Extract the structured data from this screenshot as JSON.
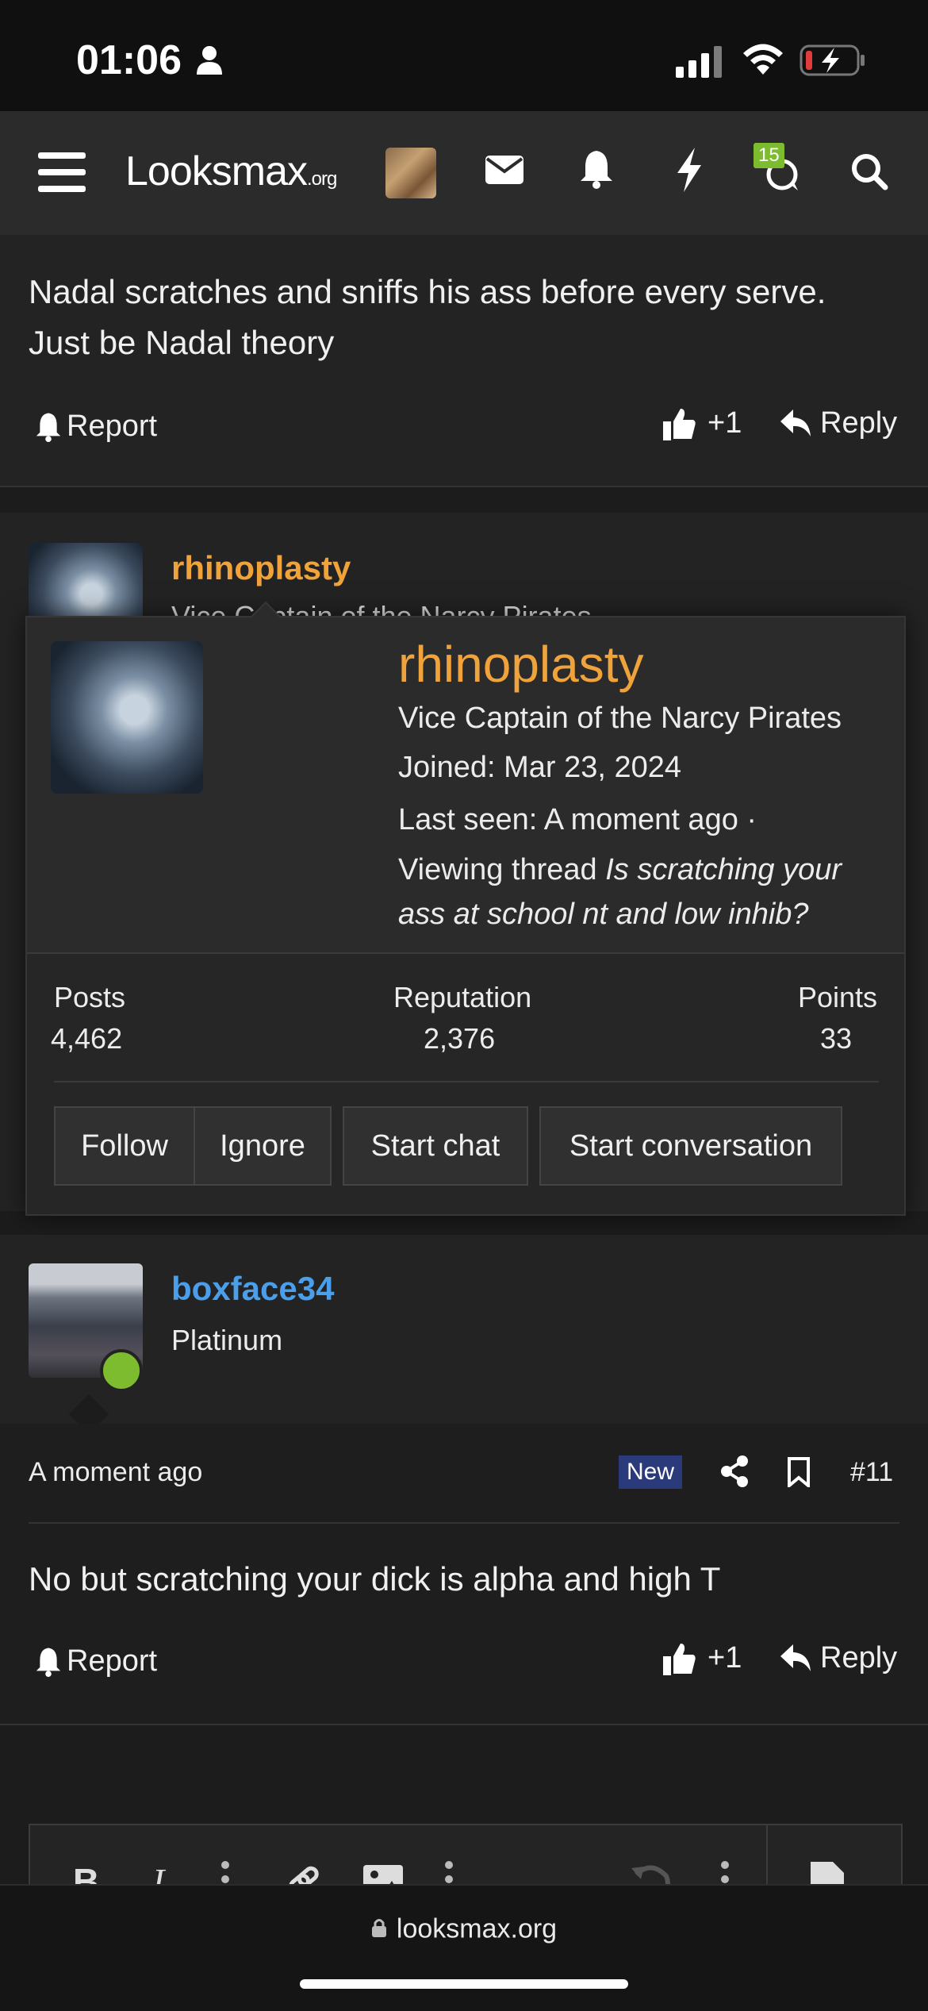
{
  "status_bar": {
    "time": "01:06"
  },
  "nav": {
    "logo_main": "Looksmax",
    "logo_suffix": ".org",
    "conversations_badge": "15"
  },
  "post1": {
    "text_line1": "Nadal scratches and sniffs his ass before every serve.",
    "text_line2": "Just be Nadal theory",
    "report_label": "Report",
    "like_label": "+1",
    "reply_label": "Reply"
  },
  "post2_header": {
    "username": "rhinoplasty",
    "subtitle_partial": "Vice Captain of the Narcy Pirates"
  },
  "popup": {
    "username": "rhinoplasty",
    "title": "Vice Captain of the Narcy Pirates",
    "joined": "Joined: Mar 23, 2024",
    "last_seen": "Last seen: A moment ago ·",
    "viewing_prefix": "Viewing thread ",
    "viewing_thread_line1": "Is scratching your",
    "viewing_thread_line2": "ass at school nt and low inhib?",
    "stats": [
      {
        "label": "Posts",
        "value": "4,462"
      },
      {
        "label": "Reputation",
        "value": "2,376"
      },
      {
        "label": "Points",
        "value": "33"
      }
    ],
    "buttons": [
      "Follow",
      "Ignore",
      "Start chat",
      "Start conversation"
    ]
  },
  "post3": {
    "username": "boxface34",
    "user_title": "Platinum",
    "time": "A moment ago",
    "new_badge": "New",
    "post_number": "#11",
    "text": "No but scratching your dick is alpha and high T",
    "report_label": "Report",
    "like_label": "+1",
    "reply_label": "Reply"
  },
  "browser": {
    "url": "looksmax.org"
  },
  "colors": {
    "accent_orange": "#f0a33a",
    "accent_blue": "#4a9eea",
    "online_green": "#7dbb2f",
    "new_badge_bg": "#2a3a7a"
  }
}
